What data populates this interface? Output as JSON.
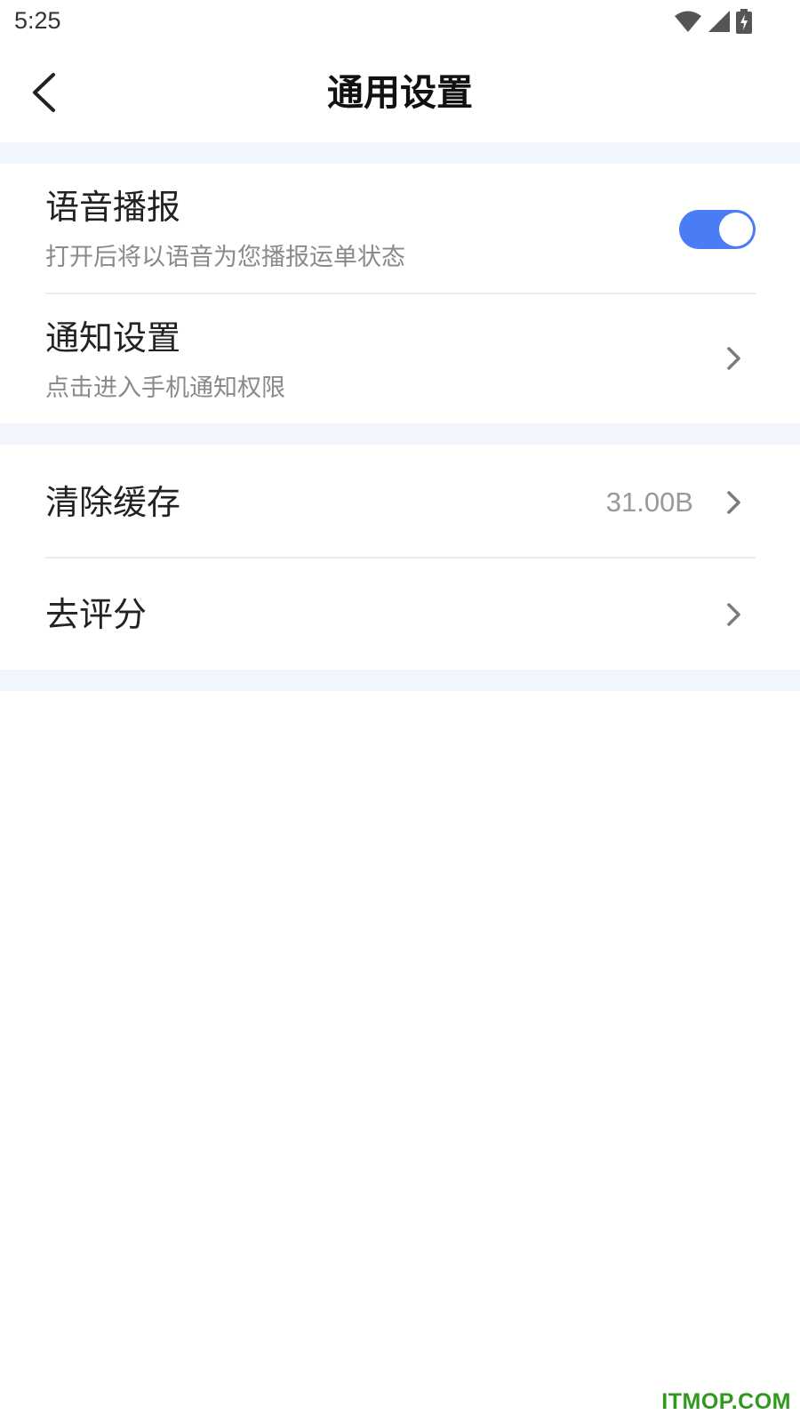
{
  "status_bar": {
    "time": "5:25",
    "icons": [
      "wifi-icon",
      "signal-icon",
      "battery-charging-icon"
    ]
  },
  "nav": {
    "title": "通用设置",
    "back_icon": "chevron-left-icon"
  },
  "settings": {
    "voice_broadcast": {
      "title": "语音播报",
      "subtitle": "打开后将以语音为您播报运单状态",
      "enabled": true
    },
    "notification_settings": {
      "title": "通知设置",
      "subtitle": "点击进入手机通知权限"
    },
    "clear_cache": {
      "title": "清除缓存",
      "value": "31.00B"
    },
    "rate": {
      "title": "去评分"
    }
  },
  "colors": {
    "accent": "#4a7cf6",
    "section_gap": "#f1f5fc",
    "watermark": "#2f9a1e"
  },
  "watermark": "ITMOP.COM"
}
